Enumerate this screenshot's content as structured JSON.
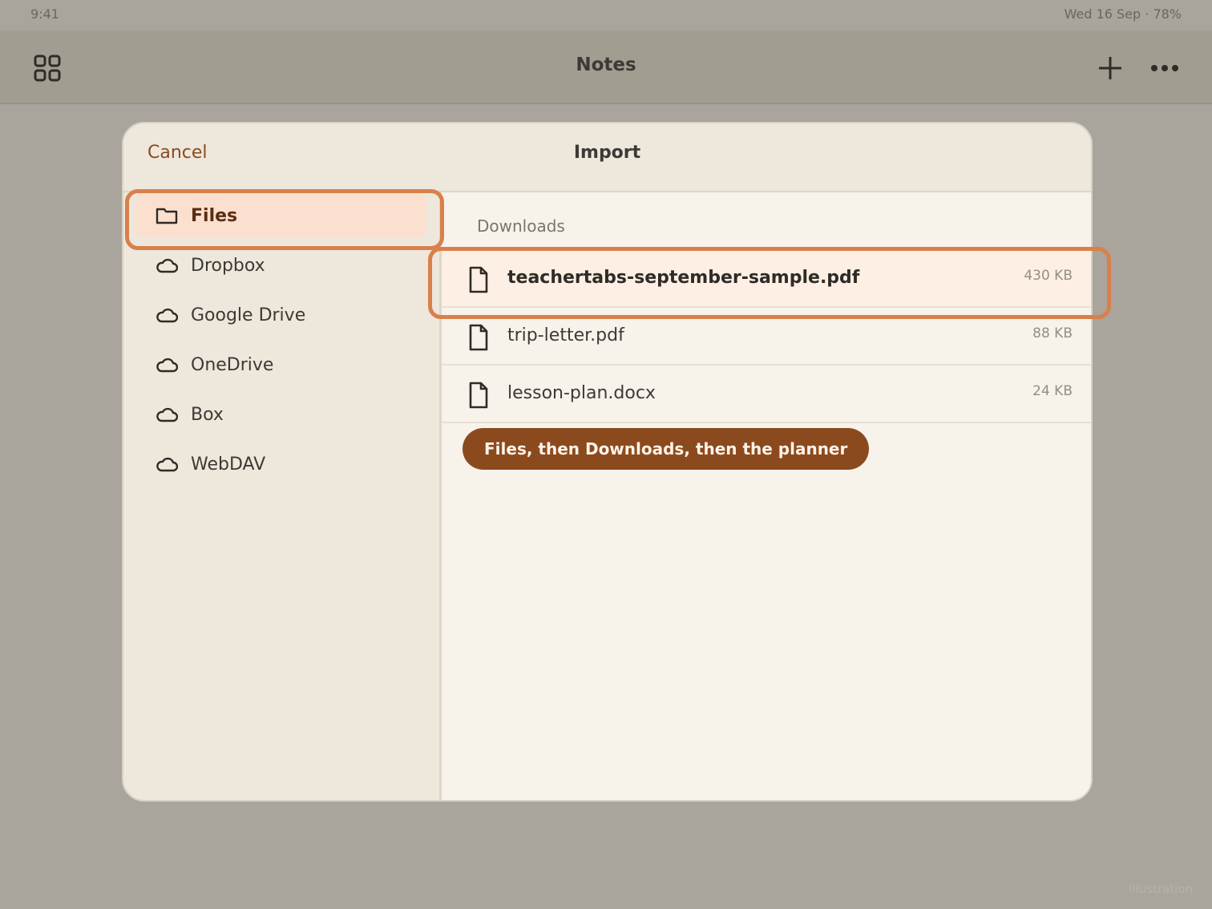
{
  "status_bar": {
    "time": "9:41",
    "right": "Wed 16 Sep · 78%"
  },
  "topbar": {
    "title": "Notes"
  },
  "sheet": {
    "cancel_label": "Cancel",
    "title": "Import",
    "sources": [
      {
        "label": "Files",
        "icon": "folder-icon",
        "selected": true
      },
      {
        "label": "Dropbox",
        "icon": "cloud-icon",
        "selected": false
      },
      {
        "label": "Google Drive",
        "icon": "cloud-icon",
        "selected": false
      },
      {
        "label": "OneDrive",
        "icon": "cloud-icon",
        "selected": false
      },
      {
        "label": "Box",
        "icon": "cloud-icon",
        "selected": false
      },
      {
        "label": "WebDAV",
        "icon": "cloud-icon",
        "selected": false
      }
    ],
    "folder_label": "Downloads",
    "files": [
      {
        "name": "teachertabs-september-sample.pdf",
        "size": "430 KB",
        "selected": true
      },
      {
        "name": "trip-letter.pdf",
        "size": "88 KB",
        "selected": false
      },
      {
        "name": "lesson-plan.docx",
        "size": "24 KB",
        "selected": false
      }
    ],
    "hint": "Files, then Downloads, then the planner"
  },
  "watermark": "Illustration",
  "colors": {
    "accent": "#8b4a1e",
    "highlight": "#d9804a",
    "selected_bg": "#fbe0cf"
  }
}
